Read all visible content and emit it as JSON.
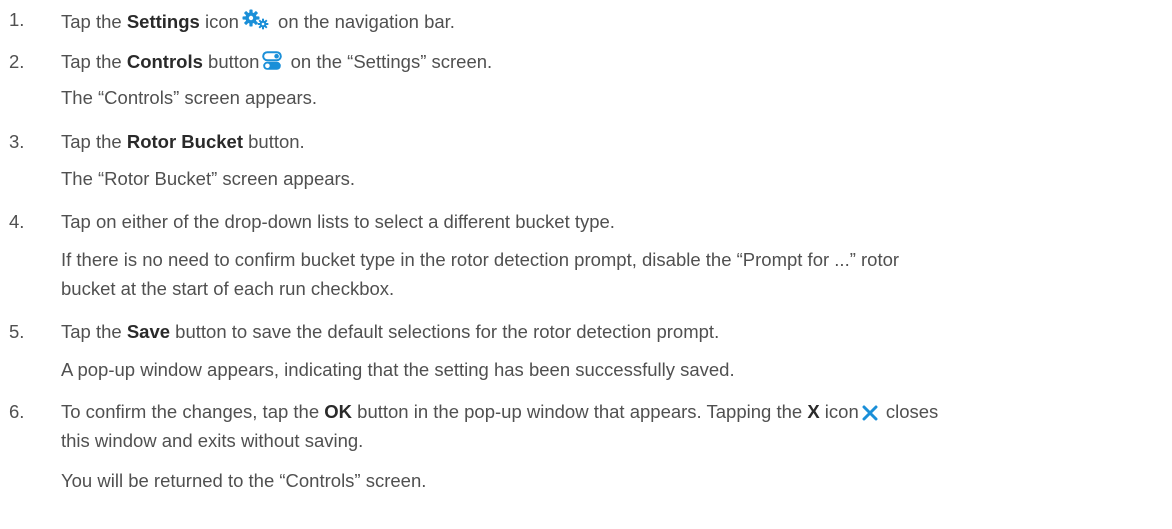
{
  "colors": {
    "text": "#505050",
    "bold": "#2a2a2a",
    "icon_blue": "#1a8fd8"
  },
  "steps": [
    {
      "number": "1.",
      "line1": {
        "a": "Tap the ",
        "b": "Settings",
        "c": " icon",
        "icon": "settings-gears-icon",
        "d": " on the navigation bar."
      }
    },
    {
      "number": "2.",
      "line1": {
        "a": "Tap the ",
        "b": "Controls",
        "c": " button",
        "icon": "controls-toggle-icon",
        "d": " on the “Settings” screen."
      },
      "note": "The “Controls” screen appears."
    },
    {
      "number": "3.",
      "line1": {
        "a": "Tap the ",
        "b": "Rotor Bucket",
        "c": " button."
      },
      "note": "The “Rotor Bucket” screen appears."
    },
    {
      "number": "4.",
      "line1": "Tap on either of the drop-down lists to select a different bucket type.",
      "note_line1": "If there is no need to confirm bucket type in the rotor detection prompt, disable the “Prompt for ...” rotor",
      "note_line2": "bucket at the start of each run checkbox."
    },
    {
      "number": "5.",
      "line1": {
        "a": "Tap the ",
        "b": "Save",
        "c": " button to save the default selections for the rotor detection prompt."
      },
      "note": "A pop-up window appears, indicating that the setting has been successfully saved."
    },
    {
      "number": "6.",
      "line1": {
        "a": "To confirm the changes, tap the ",
        "b": "OK",
        "c": " button in the pop-up window that appears. Tapping the ",
        "b2": "X",
        "c2": " icon",
        "icon": "close-x-icon",
        "d": " closes"
      },
      "line2": "this window and exits without saving.",
      "note": "You will be returned to the “Controls” screen."
    }
  ]
}
